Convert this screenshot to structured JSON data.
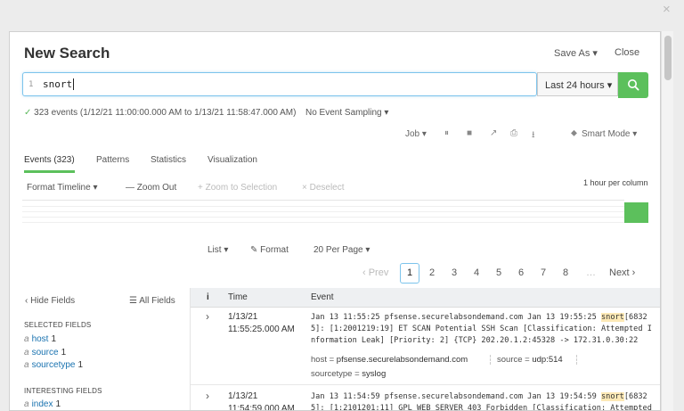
{
  "overlay": {
    "close_glyph": "×"
  },
  "header": {
    "title": "New Search",
    "save_as": "Save As ▾",
    "close": "Close"
  },
  "search": {
    "line_no": "1",
    "query": "snort",
    "time_range": "Last 24 hours ▾"
  },
  "status": {
    "check": "✓",
    "summary": "323 events (1/12/21 11:00:00.000 AM to 1/13/21 11:58:47.000 AM)",
    "sampling": "No Event Sampling ▾"
  },
  "toolbar": {
    "job": "Job ▾",
    "pause_icon": "⏸",
    "stop_icon": "■",
    "share_icon": "↗",
    "print_icon": "⎙",
    "export_icon": "⭳",
    "mode_pin": "⬥",
    "mode": "Smart Mode ▾"
  },
  "tabs": [
    {
      "label": "Events (323)",
      "active": true
    },
    {
      "label": "Patterns"
    },
    {
      "label": "Statistics"
    },
    {
      "label": "Visualization"
    }
  ],
  "timeline": {
    "format": "Format Timeline ▾",
    "zoom_out": "— Zoom Out",
    "zoom_sel": "+ Zoom to Selection",
    "deselect": "× Deselect",
    "scale": "1 hour per column",
    "bar_level": 1
  },
  "results_opts": {
    "list": "List ▾",
    "format_icon": "✎",
    "format": "Format",
    "per_page": "20 Per Page ▾"
  },
  "pagination": {
    "prev": "‹ Prev",
    "pages": [
      "1",
      "2",
      "3",
      "4",
      "5",
      "6",
      "7",
      "8"
    ],
    "ellipsis": "…",
    "next": "Next ›",
    "current": "1"
  },
  "sidebar": {
    "hide_fields": "‹ Hide Fields",
    "all_fields_icon": "☰",
    "all_fields": "All Fields",
    "selected_header": "SELECTED FIELDS",
    "selected": [
      {
        "type": "a",
        "name": "host",
        "count": "1"
      },
      {
        "type": "a",
        "name": "source",
        "count": "1"
      },
      {
        "type": "a",
        "name": "sourcetype",
        "count": "1"
      }
    ],
    "interesting_header": "INTERESTING FIELDS",
    "interesting": [
      {
        "type": "a",
        "name": "index",
        "count": "1"
      }
    ]
  },
  "table": {
    "columns": {
      "info": "i",
      "time": "Time",
      "event": "Event"
    },
    "rows": [
      {
        "expander": "›",
        "date": "1/13/21",
        "time": "11:55:25.000 AM",
        "raw_lines": [
          [
            "Jan 13 11:55:25 pfsense.securelabsondemand.com Jan 13 19:55:25 ",
            "snort",
            "[6832"
          ],
          [
            "5]: [1:2001219:19] ET SCAN Potential SSH Scan [Classification: Attempted I"
          ],
          [
            "nformation Leak] [Priority: 2] {TCP} 202.20.1.2:45328 -> 172.31.0.30:22"
          ]
        ],
        "host_key": "host = ",
        "host_val": "pfsense.securelabsondemand.com",
        "source_key": "source = ",
        "source_val": "udp:514",
        "sourcetype_key": "sourcetype = ",
        "sourcetype_val": "syslog"
      },
      {
        "expander": "›",
        "date": "1/13/21",
        "time": "11:54:59.000 AM",
        "raw_lines": [
          [
            "Jan 13 11:54:59 pfsense.securelabsondemand.com Jan 13 19:54:59 ",
            "snort",
            "[6832"
          ],
          [
            "5]: [1:2101201:11] GPL WEB_SERVER 403 Forbidden [Classification: Attempted"
          ]
        ]
      }
    ]
  },
  "colors": {
    "accent": "#5cc05c",
    "focus": "#7cc4ec",
    "link": "#1a73b0",
    "highlight": "#fde9b6"
  }
}
